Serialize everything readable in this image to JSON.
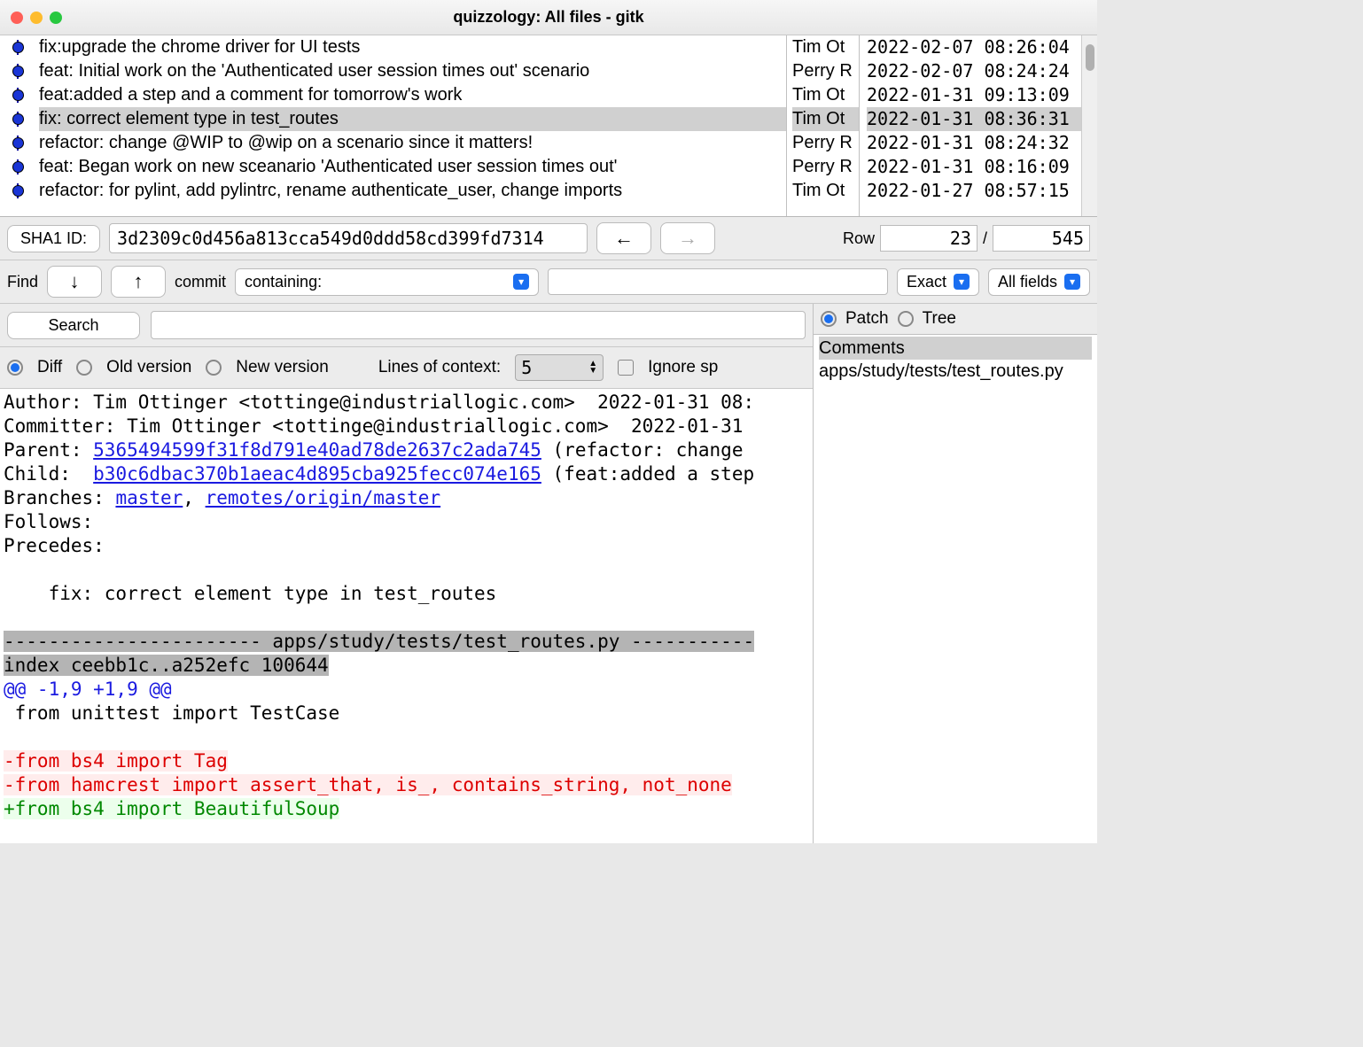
{
  "window": {
    "title": "quizzology: All files - gitk"
  },
  "commits": [
    {
      "msg": "fix:upgrade the chrome driver for UI tests",
      "author": "Tim Ot",
      "date": "2022-02-07 08:26:04",
      "selected": false
    },
    {
      "msg": "feat: Initial work on the 'Authenticated user session times out' scenario",
      "author": "Perry R",
      "date": "2022-02-07 08:24:24",
      "selected": false
    },
    {
      "msg": "feat:added a step and a comment for tomorrow's work",
      "author": "Tim Ot",
      "date": "2022-01-31 09:13:09",
      "selected": false
    },
    {
      "msg": "fix: correct element type in test_routes",
      "author": "Tim Ot",
      "date": "2022-01-31 08:36:31",
      "selected": true
    },
    {
      "msg": "refactor: change @WIP to @wip on a scenario since it matters!",
      "author": "Perry R",
      "date": "2022-01-31 08:24:32",
      "selected": false
    },
    {
      "msg": "feat: Began work on new sceanario 'Authenticated user session times out'",
      "author": "Perry R",
      "date": "2022-01-31 08:16:09",
      "selected": false
    },
    {
      "msg": "refactor: for pylint, add pylintrc, rename authenticate_user, change imports",
      "author": "Tim Ot",
      "date": "2022-01-27 08:57:15",
      "selected": false
    }
  ],
  "sha_row": {
    "label": "SHA1 ID:",
    "sha": "3d2309c0d456a813cca549d0ddd58cd399fd7314",
    "row_label": "Row",
    "current_row": "23",
    "sep": "/",
    "total_rows": "545"
  },
  "find_row": {
    "label": "Find",
    "commit_label": "commit",
    "containing_label": "containing:",
    "exact_label": "Exact",
    "allfields_label": "All fields"
  },
  "search": {
    "button": "Search"
  },
  "opts": {
    "diff": "Diff",
    "old": "Old version",
    "newv": "New version",
    "loc_label": "Lines of context:",
    "loc_value": "5",
    "ignore_sp": "Ignore sp"
  },
  "patch_tree": {
    "patch": "Patch",
    "tree": "Tree"
  },
  "file_panel": {
    "comments": "Comments",
    "file": "apps/study/tests/test_routes.py"
  },
  "diff": {
    "author_line": "Author: Tim Ottinger <tottinge@industriallogic.com>  2022-01-31 08:",
    "committer_line": "Committer: Tim Ottinger <tottinge@industriallogic.com>  2022-01-31",
    "parent_prefix": "Parent: ",
    "parent_hash": "5365494599f31f8d791e40ad78de2637c2ada745",
    "parent_suffix": " (refactor: change",
    "child_prefix": "Child:  ",
    "child_hash": "b30c6dbac370b1aeac4d895cba925fecc074e165",
    "child_suffix": " (feat:added a step",
    "branches_prefix": "Branches: ",
    "branch1": "master",
    "branch_sep": ", ",
    "branch2": "remotes/origin/master",
    "follows": "Follows:",
    "precedes": "Precedes:",
    "subject": "    fix: correct element type in test_routes",
    "file_header": "----------------------- apps/study/tests/test_routes.py -----------",
    "index_line": "index ceebb1c..a252efc 100644",
    "hunk": "@@ -1,9 +1,9 @@",
    "ctx1": " from unittest import TestCase",
    "del1": "-from bs4 import Tag",
    "del2": "-from hamcrest import assert_that, is_, contains_string, not_none",
    "add1": "+from bs4 import BeautifulSoup"
  }
}
